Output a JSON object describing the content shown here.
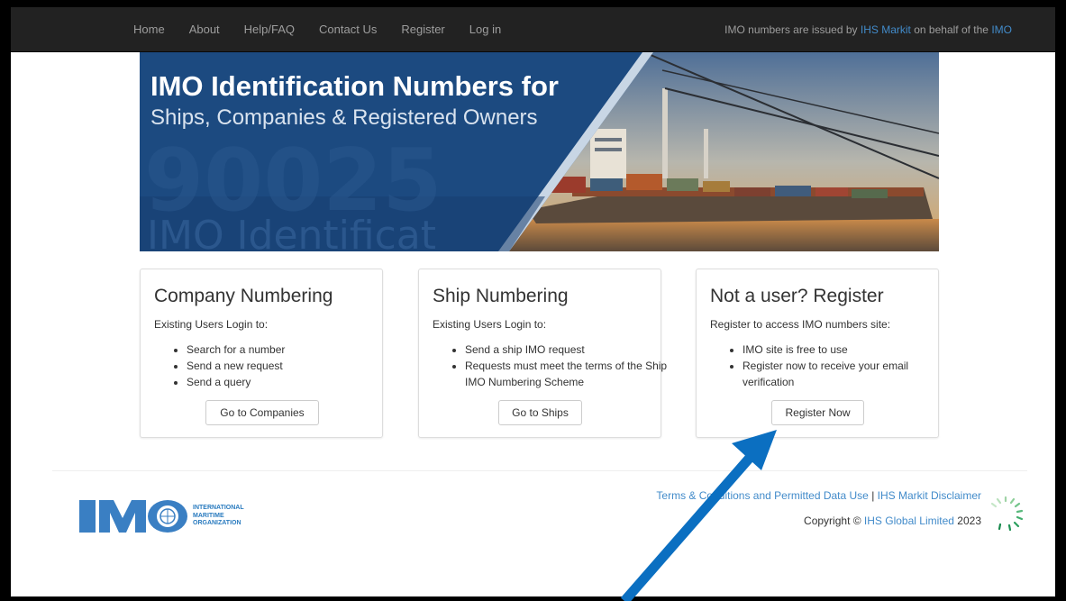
{
  "nav": {
    "items": [
      {
        "label": "Home"
      },
      {
        "label": "About"
      },
      {
        "label": "Help/FAQ"
      },
      {
        "label": "Contact Us"
      },
      {
        "label": "Register"
      },
      {
        "label": "Log in"
      }
    ],
    "notice_prefix": "IMO numbers are issued by ",
    "notice_link1": "IHS Markit",
    "notice_middle": " on behalf of the ",
    "notice_link2": "IMO"
  },
  "banner": {
    "title": "IMO Identification Numbers for",
    "subtitle": "Ships, Companies & Registered Owners",
    "watermark_number": "90025",
    "watermark_text": "IMO Identificat"
  },
  "cards": [
    {
      "title": "Company Numbering",
      "subtitle": "Existing Users Login to:",
      "items": [
        "Search for a number",
        "Send a new request",
        "Send a query"
      ],
      "button": "Go to Companies"
    },
    {
      "title": "Ship Numbering",
      "subtitle": "Existing Users Login to:",
      "items": [
        "Send a ship IMO request",
        "Requests must meet the terms of the Ship IMO Numbering Scheme"
      ],
      "button": "Go to Ships"
    },
    {
      "title": "Not a user? Register",
      "subtitle": "Register to access IMO numbers site:",
      "items": [
        "IMO site is free to use",
        "Register now to receive your email verification"
      ],
      "button": "Register Now"
    }
  ],
  "footer": {
    "imo_logo_text": "IMO",
    "imo_org": [
      "INTERNATIONAL",
      "MARITIME",
      "ORGANIZATION"
    ],
    "terms_link": "Terms & Conditions and Permitted Data Use",
    "separator": " | ",
    "disclaimer_link": "IHS Markit Disclaimer",
    "copyright_prefix": "Copyright © ",
    "copyright_link": "IHS Global Limited",
    "copyright_year": " 2023"
  },
  "colors": {
    "navbar_bg": "#222222",
    "link": "#428bca",
    "annotation_arrow": "#0b6fc1"
  }
}
